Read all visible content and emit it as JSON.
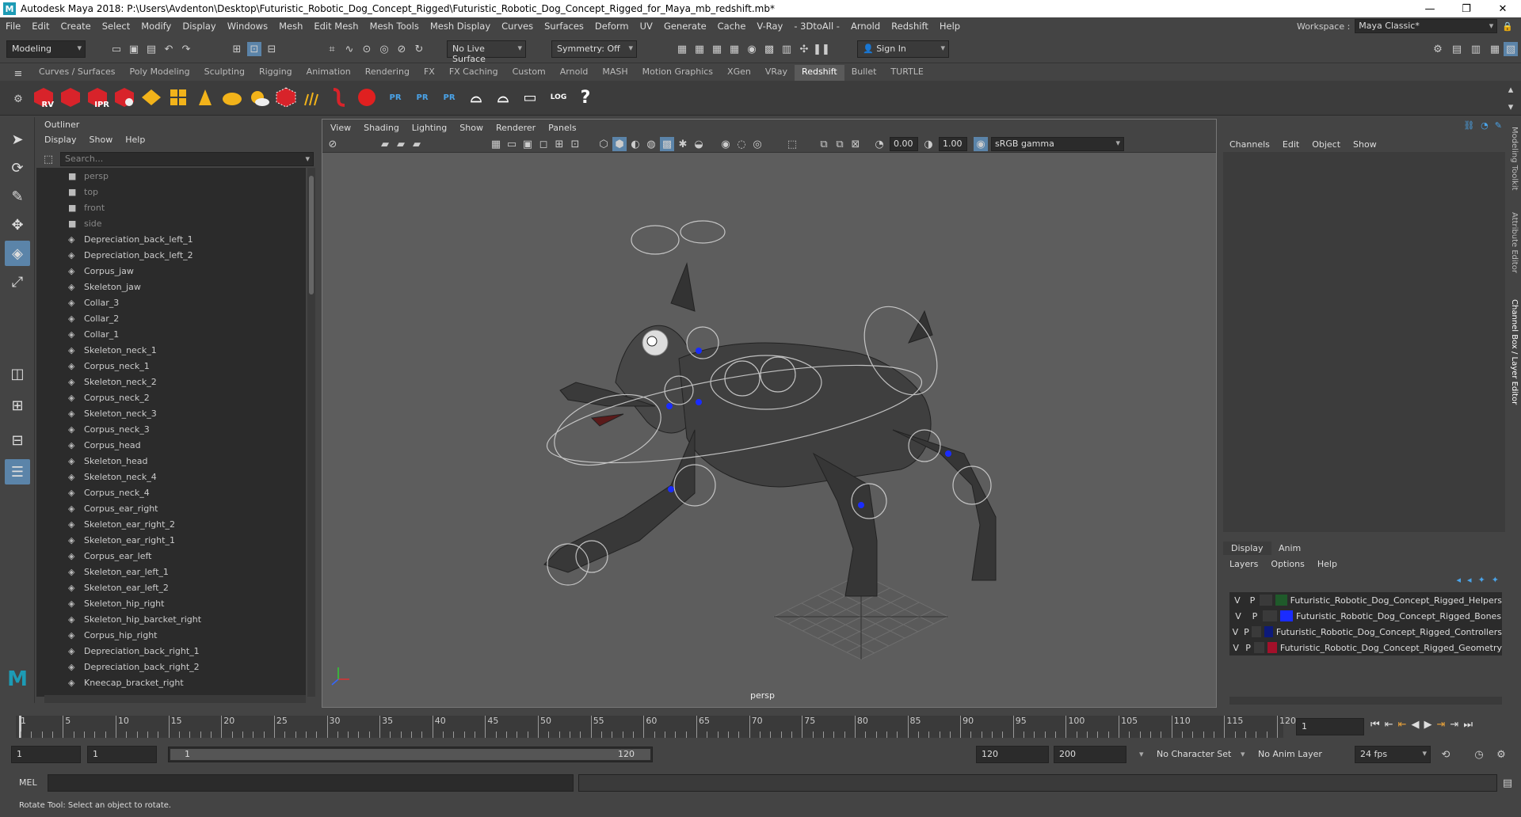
{
  "titlebar": {
    "title": "Autodesk Maya 2018: P:\\Users\\Avdenton\\Desktop\\Futuristic_Robotic_Dog_Concept_Rigged\\Futuristic_Robotic_Dog_Concept_Rigged_for_Maya_mb_redshift.mb*",
    "logo": "M"
  },
  "menubar": {
    "items": [
      "File",
      "Edit",
      "Create",
      "Select",
      "Modify",
      "Display",
      "Windows",
      "Mesh",
      "Edit Mesh",
      "Mesh Tools",
      "Mesh Display",
      "Curves",
      "Surfaces",
      "Deform",
      "UV",
      "Generate",
      "Cache",
      "V-Ray",
      "- 3DtoAll -",
      "Arnold",
      "Redshift",
      "Help"
    ],
    "workspace_label": "Workspace :",
    "workspace_value": "Maya Classic*"
  },
  "statusline": {
    "mode": "Modeling",
    "live_surface": "No Live Surface",
    "symmetry": "Symmetry: Off",
    "sign_in": "Sign In"
  },
  "shelf": {
    "tabs": [
      "Curves / Surfaces",
      "Poly Modeling",
      "Sculpting",
      "Rigging",
      "Animation",
      "Rendering",
      "FX",
      "FX Caching",
      "Custom",
      "Arnold",
      "MASH",
      "Motion Graphics",
      "XGen",
      "VRay",
      "Redshift",
      "Bullet",
      "TURTLE"
    ],
    "active_tab": "Redshift",
    "icon_labels": {
      "rv": "RV",
      "ipr": "IPR",
      "pr": "PR",
      "log": "LOG"
    }
  },
  "outliner": {
    "title": "Outliner",
    "menu": [
      "Display",
      "Show",
      "Help"
    ],
    "search_placeholder": "Search...",
    "cameras": [
      "persp",
      "top",
      "front",
      "side"
    ],
    "items": [
      "Depreciation_back_left_1",
      "Depreciation_back_left_2",
      "Corpus_jaw",
      "Skeleton_jaw",
      "Collar_3",
      "Collar_2",
      "Collar_1",
      "Skeleton_neck_1",
      "Corpus_neck_1",
      "Skeleton_neck_2",
      "Corpus_neck_2",
      "Skeleton_neck_3",
      "Corpus_neck_3",
      "Corpus_head",
      "Skeleton_head",
      "Skeleton_neck_4",
      "Corpus_neck_4",
      "Corpus_ear_right",
      "Skeleton_ear_right_2",
      "Skeleton_ear_right_1",
      "Corpus_ear_left",
      "Skeleton_ear_left_1",
      "Skeleton_ear_left_2",
      "Skeleton_hip_right",
      "Skeleton_hip_barcket_right",
      "Corpus_hip_right",
      "Depreciation_back_right_1",
      "Depreciation_back_right_2",
      "Kneecap_bracket_right"
    ]
  },
  "viewport": {
    "menu": [
      "View",
      "Shading",
      "Lighting",
      "Show",
      "Renderer",
      "Panels"
    ],
    "exposure": "0.00",
    "gamma": "1.00",
    "colorspace": "sRGB gamma",
    "camera_label": "persp"
  },
  "channelbox": {
    "menu": [
      "Channels",
      "Edit",
      "Object",
      "Show"
    ]
  },
  "layers": {
    "tabs": [
      "Display",
      "Anim"
    ],
    "menu": [
      "Layers",
      "Options",
      "Help"
    ],
    "rows": [
      {
        "v": "V",
        "p": "P",
        "name": "Futuristic_Robotic_Dog_Concept_Rigged_Helpers",
        "color": "#1f5a2a"
      },
      {
        "v": "V",
        "p": "P",
        "name": "Futuristic_Robotic_Dog_Concept_Rigged_Bones",
        "color": "#1a2cff"
      },
      {
        "v": "V",
        "p": "P",
        "name": "Futuristic_Robotic_Dog_Concept_Rigged_Controllers",
        "color": "#0d1a7a"
      },
      {
        "v": "V",
        "p": "P",
        "name": "Futuristic_Robotic_Dog_Concept_Rigged_Geometry",
        "color": "#a3102a"
      }
    ]
  },
  "sidetabs": [
    "Modeling Toolkit",
    "Attribute Editor",
    "Channel Box / Layer Editor"
  ],
  "timeline": {
    "ticks": [
      "5",
      "10",
      "15",
      "20",
      "25",
      "30",
      "35",
      "40",
      "45",
      "50",
      "55",
      "60",
      "65",
      "70",
      "75",
      "80",
      "85",
      "90",
      "95",
      "100",
      "105",
      "110",
      "115",
      "120"
    ],
    "start": "1",
    "current_frame": "1"
  },
  "range": {
    "start": "1",
    "anim_start": "1",
    "slider_start": "1",
    "slider_end": "120",
    "end": "120",
    "anim_end": "200",
    "character_set": "No Character Set",
    "anim_layer": "No Anim Layer",
    "fps": "24 fps"
  },
  "cmdline": {
    "label": "MEL"
  },
  "helpline": {
    "text": "Rotate Tool: Select an object to rotate."
  }
}
